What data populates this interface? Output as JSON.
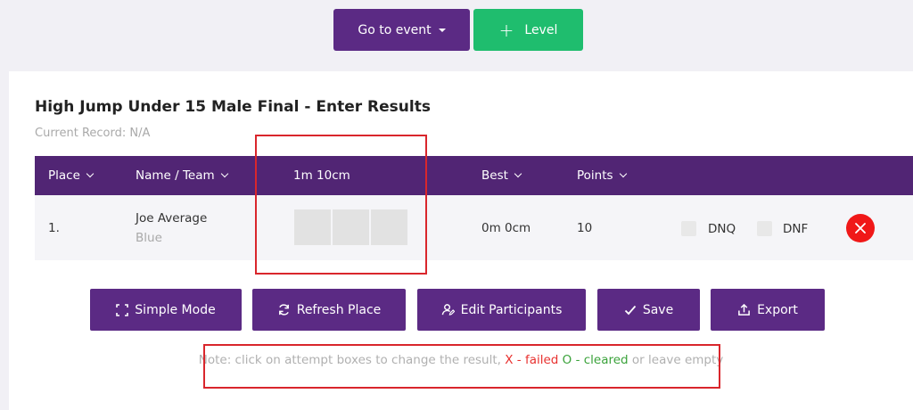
{
  "toolbar": {
    "goto_event_label": "Go to event",
    "level_label": "Level"
  },
  "event": {
    "title": "High Jump Under 15 Male Final - Enter Results",
    "current_record": "Current Record: N/A"
  },
  "table": {
    "headers": {
      "place": "Place",
      "name_team": "Name / Team",
      "height": "1m 10cm",
      "best": "Best",
      "points": "Points"
    },
    "rows": [
      {
        "place": "1.",
        "name": "Joe Average",
        "team": "Blue",
        "best": "0m 0cm",
        "points": "10",
        "dnq_label": "DNQ",
        "dnf_label": "DNF"
      }
    ]
  },
  "actions": {
    "simple_mode": "Simple Mode",
    "refresh_place": "Refresh Place",
    "edit_participants": "Edit Participants",
    "save": "Save",
    "export": "Export"
  },
  "note": {
    "prefix": "Note: click on attempt boxes to change the result,",
    "x_label": "X - failed",
    "o_label": "O - cleared",
    "suffix": "or leave empty"
  },
  "colors": {
    "primary": "#5b2a84",
    "header": "#512574",
    "success": "#1fbd6e",
    "danger": "#f01818",
    "highlight": "#d9262c"
  }
}
